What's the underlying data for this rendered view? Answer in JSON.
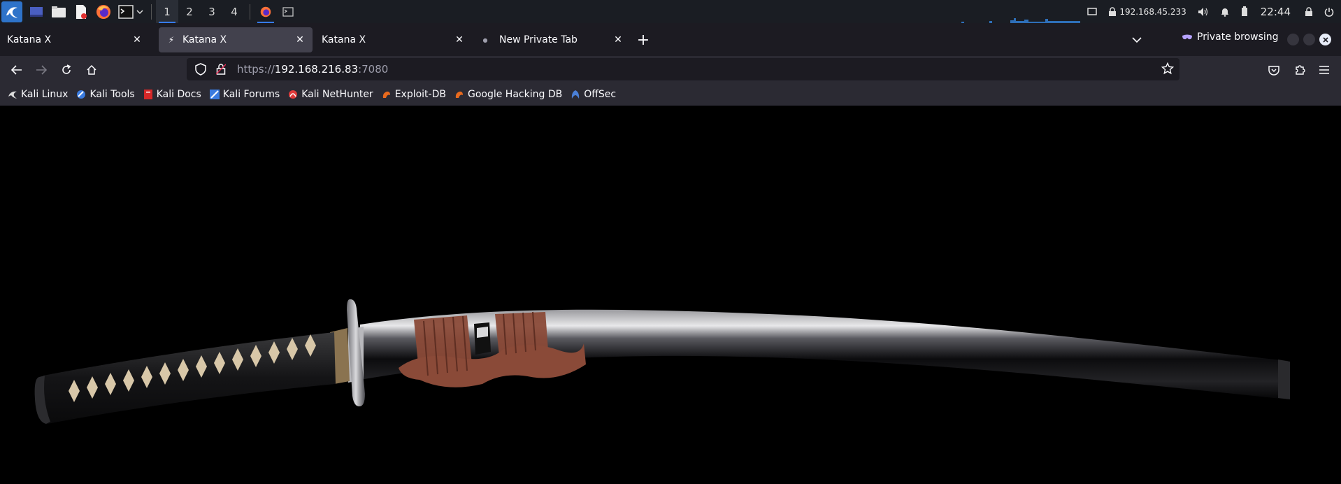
{
  "panel": {
    "workspaces": [
      "1",
      "2",
      "3",
      "4"
    ],
    "active_workspace": "1",
    "ip_address": "192.168.45.233",
    "clock": "22:44",
    "accent": "#367bf0"
  },
  "tabs": [
    {
      "label": "Katana X",
      "selected": false
    },
    {
      "label": "Katana X",
      "selected": true
    },
    {
      "label": "Katana X",
      "selected": false
    },
    {
      "label": "New Private Tab",
      "selected": false
    }
  ],
  "private_label": "Private browsing",
  "url": {
    "scheme": "https://",
    "host": "192.168.216.83",
    "port": ":7080"
  },
  "bookmarks": [
    {
      "label": "Kali Linux",
      "icon": "kali-dragon-icon"
    },
    {
      "label": "Kali Tools",
      "icon": "kali-tools-icon"
    },
    {
      "label": "Kali Docs",
      "icon": "kali-docs-icon"
    },
    {
      "label": "Kali Forums",
      "icon": "kali-forums-icon"
    },
    {
      "label": "Kali NetHunter",
      "icon": "nethunter-icon"
    },
    {
      "label": "Exploit-DB",
      "icon": "exploit-db-icon"
    },
    {
      "label": "Google Hacking DB",
      "icon": "ghdb-icon"
    },
    {
      "label": "OffSec",
      "icon": "offsec-icon"
    }
  ],
  "colors": {
    "panel_bg": "#1a1d23",
    "tabstrip_bg": "#1c1b22",
    "toolbar_bg": "#2b2a33",
    "content_bg": "#000000"
  }
}
